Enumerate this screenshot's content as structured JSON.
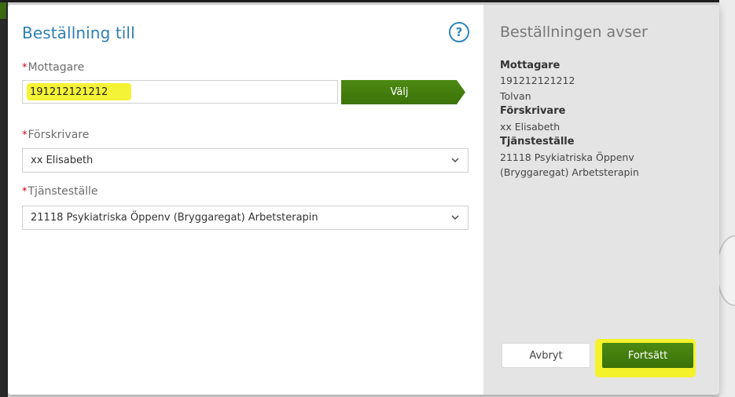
{
  "form": {
    "title": "Beställning till",
    "help_icon_glyph": "?",
    "required_marker": "*",
    "mottagare_label": "Mottagare",
    "mottagare_value": "191212121212",
    "valj_label": "Välj",
    "forskrivare_label": "Förskrivare",
    "forskrivare_selected": "xx Elisabeth",
    "tjanstestalle_label": "Tjänsteställe",
    "tjanstestalle_selected": "21118 Psykiatriska Öppenv (Bryggaregat) Arbetsterapin"
  },
  "summary": {
    "title": "Beställningen avser",
    "mottagare_heading": "Mottagare",
    "mottagare_id": "191212121212",
    "mottagare_name": "Tolvan",
    "forskrivare_heading": "Förskrivare",
    "forskrivare_value": "xx Elisabeth",
    "tjanstestalle_heading": "Tjänsteställe",
    "tjanstestalle_line1": "21118 Psykiatriska Öppenv",
    "tjanstestalle_line2": "(Bryggaregat) Arbetsterapin"
  },
  "actions": {
    "cancel_label": "Avbryt",
    "continue_label": "Fortsätt"
  },
  "icons": {
    "help": "help-circle-icon",
    "select_chevron": "chevron-down-icon"
  },
  "colors": {
    "accent_green": "#3f7a0c",
    "title_blue": "#2e7fb3",
    "required_red": "#d0021b",
    "highlight_yellow": "#f4f22a",
    "summary_bg": "#e4e4e4"
  }
}
